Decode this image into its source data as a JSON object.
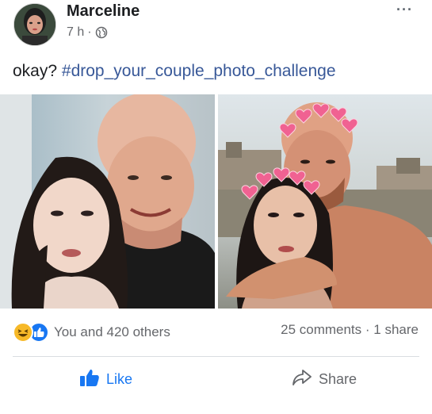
{
  "post": {
    "author": "Marceline",
    "time": "7 h",
    "separator": "·",
    "more": "···",
    "text": "okay?",
    "hashtag": "#drop_your_couple_photo_challenge"
  },
  "reactions": {
    "summary": "You and 420 others",
    "icons": [
      "haha-icon",
      "like-icon"
    ]
  },
  "engagement": {
    "comments": "25 comments",
    "dot": "·",
    "shares": "1 share"
  },
  "actions": {
    "like_label": "Like",
    "share_label": "Share"
  },
  "colors": {
    "link": "#385898",
    "like_blue": "#1877f2",
    "secondary_text": "#65676b"
  }
}
